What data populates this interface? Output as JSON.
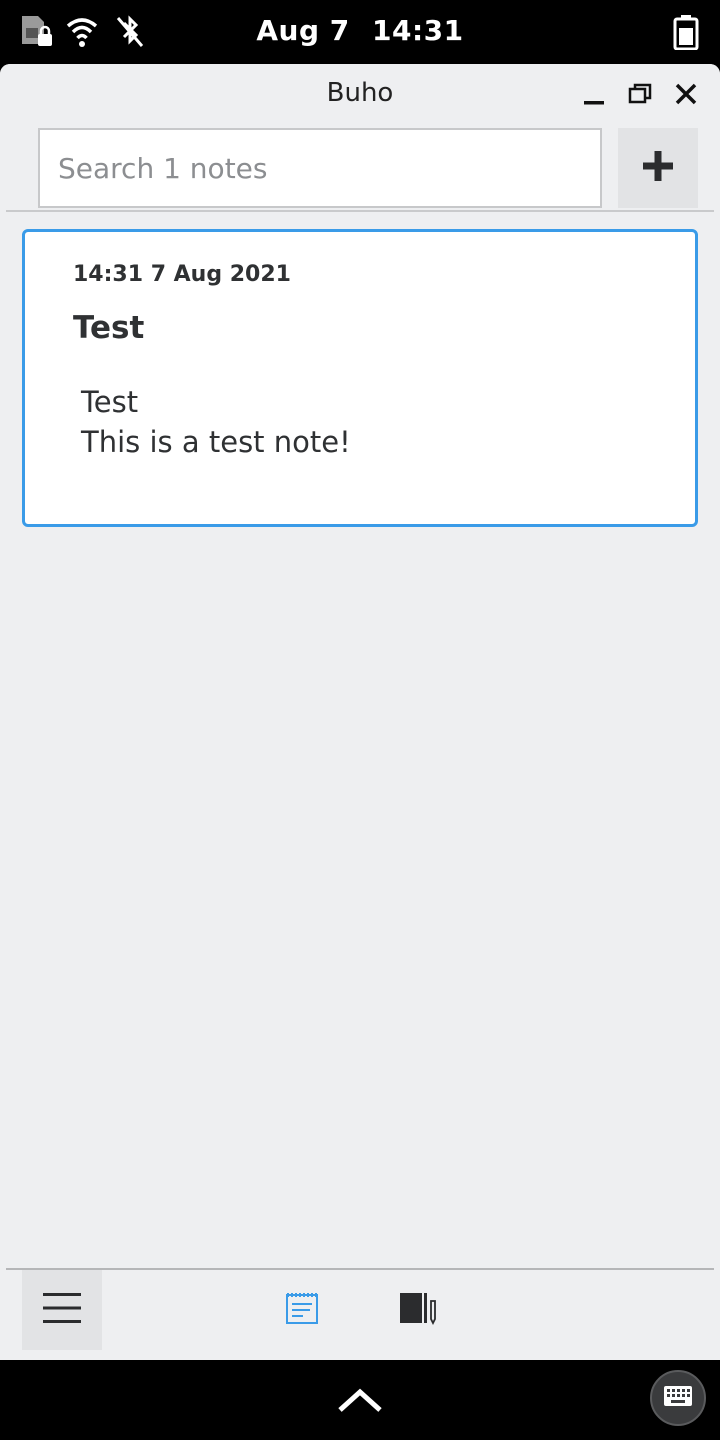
{
  "status_bar": {
    "date": "Aug 7",
    "time": "14:31",
    "icons": [
      "sim-locked-icon",
      "wifi-icon",
      "bluetooth-disabled-icon",
      "battery-icon"
    ]
  },
  "window": {
    "title": "Buho",
    "controls": [
      "minimize-icon",
      "maximize-icon",
      "close-icon"
    ]
  },
  "search": {
    "placeholder": "Search 1 notes",
    "value": ""
  },
  "add_button": {
    "icon": "plus-icon"
  },
  "notes": [
    {
      "date": "14:31 7 Aug 2021",
      "title": "Test",
      "body_lines": [
        "Test",
        "This is a test note!"
      ]
    }
  ],
  "bottom_bar": {
    "menu_icon": "hamburger-menu-icon",
    "views": [
      {
        "icon": "notes-view-icon",
        "active": true
      },
      {
        "icon": "books-view-icon",
        "active": false
      }
    ]
  },
  "colors": {
    "accent": "#3a9be8",
    "window_bg": "#eeeff1",
    "text": "#2f3133"
  }
}
